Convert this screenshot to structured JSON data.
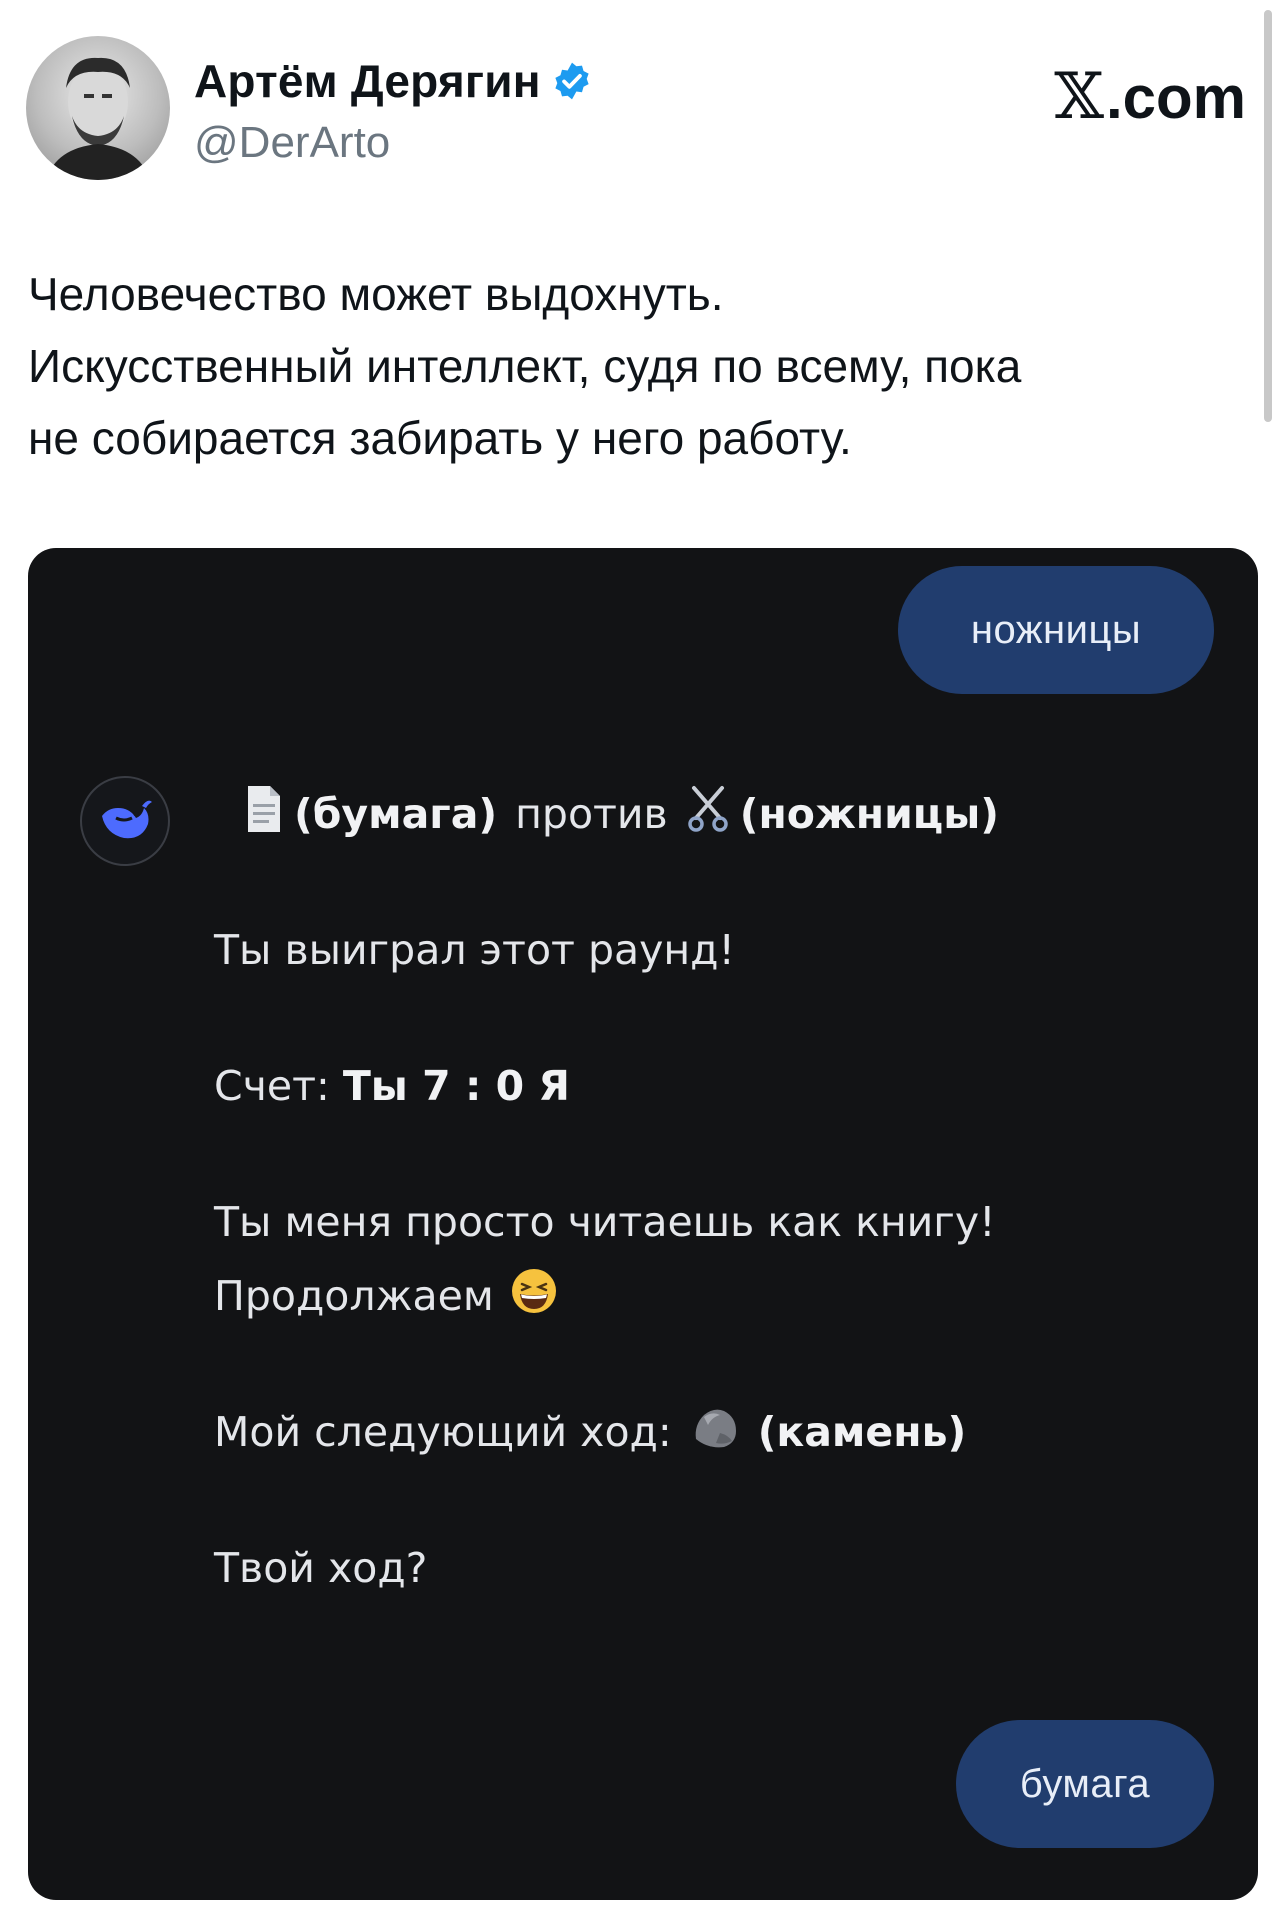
{
  "author": {
    "name": "Артём Дерягин",
    "handle": "@DerArto",
    "verified": true,
    "verified_color": "#1d9bf0"
  },
  "brand": {
    "x_glyph": "𝕏",
    "suffix": ".com"
  },
  "tweet": {
    "lines": [
      "Человечество может выдохнуть.",
      "Искусственный интеллект, судя по всему, пока",
      "не собирается забирать у него работу."
    ]
  },
  "chat": {
    "colors": {
      "background": "#121315",
      "user_bubble": "#213d6e",
      "bot_avatar": "#4d6bfe"
    },
    "user_message_1": "ножницы",
    "bot_message": {
      "line1": {
        "icon_left": "document-icon",
        "left_label": "(бумага)",
        "versus": "против",
        "icon_right": "scissors-icon",
        "right_label": "(ножницы)"
      },
      "result": "Ты выиграл этот раунд!",
      "score_prefix": "Счет:",
      "score_value": "Ты 7 : 0 Я",
      "comment_line1": "Ты меня просто читаешь как книгу!",
      "comment_line2": "Продолжаем",
      "comment_emoji": "grinning-squinting-face-icon",
      "next_move_prefix": "Мой следующий ход:",
      "next_move_icon": "rock-icon",
      "next_move_label": "(камень)",
      "question": "Твой ход?"
    },
    "user_message_2": "бумага"
  }
}
